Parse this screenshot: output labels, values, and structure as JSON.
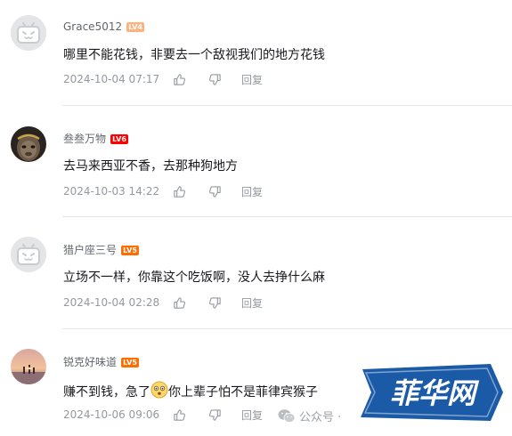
{
  "colors": {
    "lv4_badge": "#ffb27f",
    "lv5_badge": "#ff6c00",
    "lv6_badge": "#ff0000",
    "text_primary": "#18191c",
    "text_secondary": "#61666d",
    "text_muted": "#9499a0",
    "logo_blue": "#1b5aa6"
  },
  "comments": [
    {
      "username": "Grace5012",
      "level": "LV4",
      "avatar": "default-tv-avatar",
      "content": "哪里不能花钱，非要去一个敌视我们的地方花钱",
      "time": "2024-10-04 07:17",
      "reply_label": "回复"
    },
    {
      "username": "叁叁万物",
      "level": "LV6",
      "avatar": "wukong-avatar",
      "content": "去马来西亚不香，去那种狗地方",
      "time": "2024-10-03 14:22",
      "reply_label": "回复"
    },
    {
      "username": "猎户座三号",
      "level": "LV5",
      "avatar": "default-tv-avatar",
      "content": "立场不一样，你靠这个吃饭啊，没人去挣什么麻",
      "time": "2024-10-04 02:28",
      "reply_label": "回复"
    },
    {
      "username": "锐克好味道",
      "level": "LV5",
      "avatar": "sunset-avatar",
      "content_before": "赚不到钱，急了",
      "content_after": "你上辈子怕不是菲律宾猴子",
      "emoji": "shocked-emoji",
      "time": "2024-10-06 09:06",
      "reply_label": "回复"
    }
  ],
  "watermark": {
    "wechat_text": "公众号 ·",
    "site_logo_text": "菲华网"
  }
}
